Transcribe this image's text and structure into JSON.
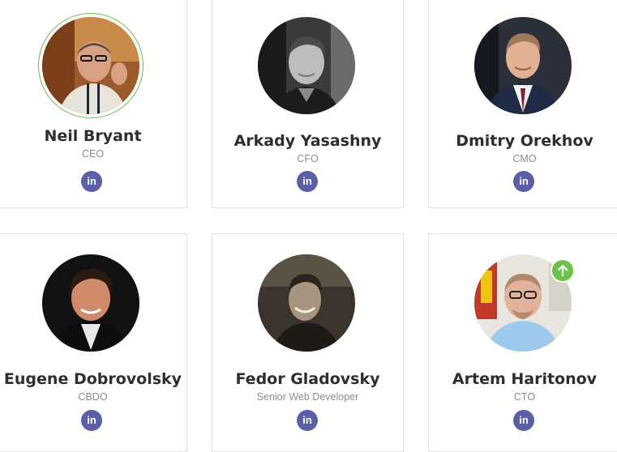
{
  "team": [
    {
      "name": "Neil Bryant",
      "role": "CEO",
      "social_icon": "linkedin-icon",
      "social_label": "in",
      "highlight": true
    },
    {
      "name": "Arkady Yasashny",
      "role": "CFO",
      "social_icon": "linkedin-icon",
      "social_label": "in"
    },
    {
      "name": "Dmitry Orekhov",
      "role": "CMO",
      "social_icon": "linkedin-icon",
      "social_label": "in"
    },
    {
      "name": "Eugene Dobrovolsky",
      "role": "CBDO",
      "social_icon": "linkedin-icon",
      "social_label": "in"
    },
    {
      "name": "Fedor Gladovsky",
      "role": "Senior Web Developer",
      "social_icon": "linkedin-icon",
      "social_label": "in"
    },
    {
      "name": "Artem Haritonov",
      "role": "CTO",
      "social_icon": "linkedin-icon",
      "social_label": "in"
    }
  ],
  "scroll_top_icon": "arrow-up-icon",
  "colors": {
    "linkedin": "#5b5fa8",
    "accent_green": "#6cc24a",
    "name_text": "#2e2e2e",
    "role_text": "#8c8c8c",
    "card_border": "#e2e2e2"
  }
}
